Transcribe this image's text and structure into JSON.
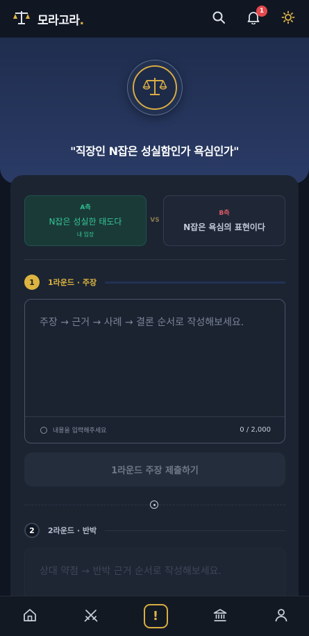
{
  "app": {
    "name": "모라고라",
    "name_dot": "."
  },
  "header": {
    "notification_count": "1",
    "icons": [
      "search-icon",
      "bell-icon",
      "sun-icon"
    ]
  },
  "debate": {
    "topic": "\"직장인 N잡은 성실함인가 욕심인가\""
  },
  "sides": {
    "a": {
      "tag": "A측",
      "text": "N잡은 성실한 태도다",
      "my_position": "내 입장"
    },
    "vs": "VS",
    "b": {
      "tag": "B측",
      "text": "N잡은 욕심의 표현이다"
    }
  },
  "round1": {
    "number": "1",
    "title": "1라운드 · 주장",
    "placeholder": "주장 → 근거 → 사례 → 결론 순서로 작성해보세요.",
    "status": "내용을 입력해주세요",
    "counter": "0 / 2,000",
    "submit_label": "1라운드 주장 제출하기"
  },
  "round2": {
    "number": "2",
    "title": "2라운드 · 반박",
    "placeholder": "상대 약점 → 반박 근거 순서로 작성해보세요."
  },
  "bottom_nav": {
    "center_label": "!",
    "icons": [
      "home-icon",
      "swords-icon",
      "alert-icon",
      "courthouse-icon",
      "profile-icon"
    ]
  },
  "colors": {
    "accent": "#dcb43f",
    "side_a": "#34c795",
    "side_b": "#e25b66"
  }
}
